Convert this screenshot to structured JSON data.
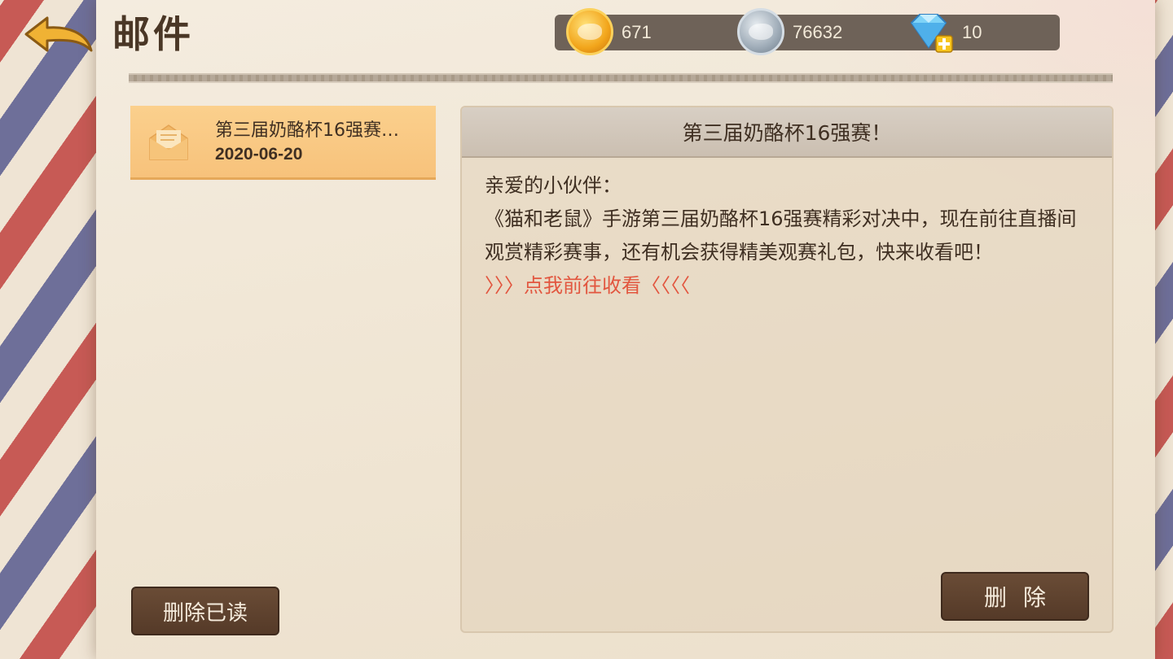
{
  "header": {
    "title": "邮件",
    "back_icon": "back-arrow-icon"
  },
  "currency": {
    "gold": {
      "icon": "gold-coin-icon",
      "value": "671"
    },
    "silver": {
      "icon": "silver-coin-icon",
      "value": "76632"
    },
    "diamond": {
      "icon": "diamond-add-icon",
      "value": "10"
    }
  },
  "mail_list": [
    {
      "subject": "第三届奶酪杯16强赛…",
      "date": "2020-06-20",
      "icon": "envelope-open-icon"
    }
  ],
  "detail": {
    "title": "第三届奶酪杯16强赛！",
    "greeting": "亲爱的小伙伴：",
    "body": "《猫和老鼠》手游第三届奶酪杯16强赛精彩对决中，现在前往直播间观赏精彩赛事，还有机会获得精美观赛礼包，快来收看吧！",
    "link": "〉〉〉点我前往收看〈〈〈〈"
  },
  "buttons": {
    "delete_read": "删除已读",
    "delete": "删除"
  },
  "colors": {
    "accent_item": "#f7c27b",
    "button_brown": "#5c412e",
    "link_red": "#e2563f"
  }
}
